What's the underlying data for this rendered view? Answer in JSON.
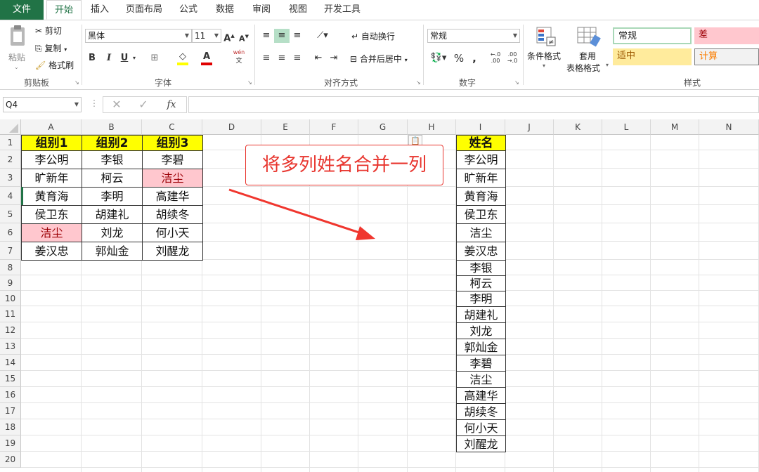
{
  "tabs": [
    "文件",
    "开始",
    "插入",
    "页面布局",
    "公式",
    "数据",
    "审阅",
    "视图",
    "开发工具"
  ],
  "clipboard": {
    "paste": "粘贴",
    "cut": "剪切",
    "copy": "复制",
    "format_painter": "格式刷",
    "group": "剪贴板"
  },
  "font": {
    "name": "黑体",
    "size": "11",
    "bold": "B",
    "italic": "I",
    "underline": "U",
    "grow": "A",
    "shrink": "A",
    "color_glyph": "A",
    "phonetic": "文",
    "group": "字体"
  },
  "alignment": {
    "wrap": "自动换行",
    "merge": "合并后居中",
    "group": "对齐方式"
  },
  "number": {
    "format": "常规",
    "percent": "%",
    "comma": ",",
    "group": "数字"
  },
  "styles": {
    "conditional": "条件格式",
    "table_format_1": "套用",
    "table_format_2": "表格格式",
    "normal": "常规",
    "bad": "差",
    "neutral": "适中",
    "calc": "计算",
    "group": "样式"
  },
  "formula_bar": {
    "name_box": "Q4",
    "fx": "fx"
  },
  "columns": [
    "A",
    "B",
    "C",
    "D",
    "E",
    "F",
    "G",
    "H",
    "I",
    "J",
    "K",
    "L",
    "M",
    "N"
  ],
  "rows": [
    "1",
    "2",
    "3",
    "4",
    "5",
    "6",
    "7",
    "8",
    "9",
    "10",
    "11",
    "12",
    "13",
    "14",
    "15",
    "16",
    "17",
    "18",
    "19",
    "20"
  ],
  "table": {
    "headers": [
      "组别1",
      "组别2",
      "组别3"
    ],
    "rows": [
      [
        "李公明",
        "李银",
        "李碧"
      ],
      [
        "旷新年",
        "柯云",
        "洁尘"
      ],
      [
        "黄育海",
        "李明",
        "高建华"
      ],
      [
        "侯卫东",
        "胡建礼",
        "胡续冬"
      ],
      [
        "洁尘",
        "刘龙",
        "何小天"
      ],
      [
        "姜汉忠",
        "郭灿金",
        "刘醒龙"
      ]
    ]
  },
  "name_list": {
    "header": "姓名",
    "values": [
      "李公明",
      "旷新年",
      "黄育海",
      "侯卫东",
      "洁尘",
      "姜汉忠",
      "李银",
      "柯云",
      "李明",
      "胡建礼",
      "刘龙",
      "郭灿金",
      "李碧",
      "洁尘",
      "高建华",
      "胡续冬",
      "何小天",
      "刘醒龙"
    ]
  },
  "callout": "将多列姓名合并一列",
  "colors": {
    "excel_green": "#217346",
    "header_yellow": "#ffff00",
    "bad_fill": "#ffc7ce",
    "neutral_fill": "#ffeb9c",
    "callout_red": "#e8352e",
    "arrow_red": "#f0362e"
  }
}
